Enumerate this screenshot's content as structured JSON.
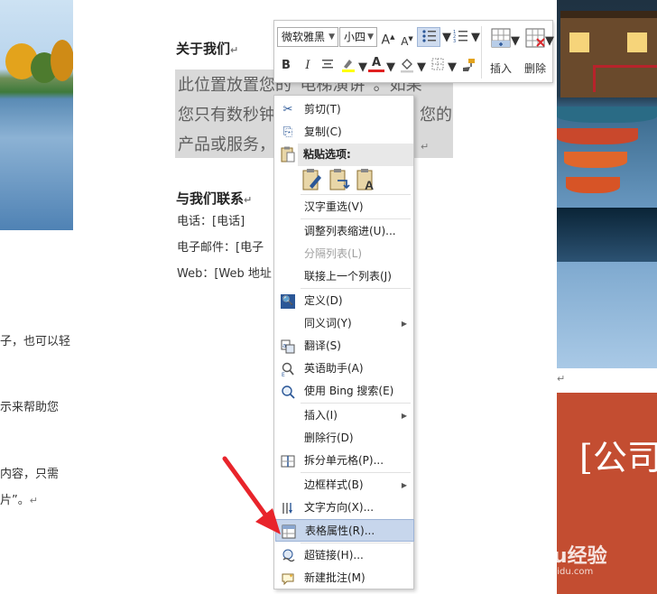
{
  "document": {
    "about_heading": "关于我们",
    "selected_lines": [
      "此位置放置您的“电梯演讲”。如果",
      "您只有数秒钟",
      "您的",
      "产品或服务，"
    ],
    "contact_heading": "与我们联系",
    "phone": "电话：[电话]",
    "email": "电子邮件：[电子",
    "web": "Web：[Web 地址",
    "left_fragments": [
      "子，也可以轻",
      "示来帮助您",
      "内容，只需",
      "片”。"
    ],
    "banner_title": "[公司",
    "para_mark": "↵"
  },
  "mini_toolbar": {
    "font_name": "微软雅黑",
    "font_size": "小四",
    "grow_font": "A",
    "shrink_font": "A",
    "bold": "B",
    "italic": "I",
    "font_color": "A",
    "insert_label": "插入",
    "delete_label": "删除",
    "colors": {
      "highlight": "#ffff00",
      "font": "#e02020",
      "accent": "#2b5797"
    }
  },
  "context_menu": {
    "items": [
      {
        "label": "剪切(T)",
        "icon": "scissors-icon",
        "glyph": "✂"
      },
      {
        "label": "复制(C)",
        "icon": "copy-icon",
        "glyph": "⎘"
      },
      {
        "label": "粘贴选项:",
        "icon": "clipboard-icon"
      },
      {
        "label": "汉字重选(V)"
      },
      {
        "label": "调整列表缩进(U)..."
      },
      {
        "label": "分隔列表(L)",
        "disabled": true
      },
      {
        "label": "联接上一个列表(J)"
      },
      {
        "label": "定义(D)",
        "icon": "define-icon"
      },
      {
        "label": "同义词(Y)",
        "submenu": true
      },
      {
        "label": "翻译(S)",
        "icon": "translate-icon"
      },
      {
        "label": "英语助手(A)",
        "icon": "english-assistant-icon"
      },
      {
        "label": "使用 Bing 搜索(E)",
        "icon": "bing-search-icon"
      },
      {
        "label": "插入(I)",
        "submenu": true
      },
      {
        "label": "删除行(D)"
      },
      {
        "label": "拆分单元格(P)...",
        "icon": "split-cell-icon"
      },
      {
        "label": "边框样式(B)",
        "submenu": true
      },
      {
        "label": "文字方向(X)...",
        "icon": "text-direction-icon"
      },
      {
        "label": "表格属性(R)...",
        "icon": "table-properties-icon",
        "highlighted": true
      },
      {
        "label": "超链接(H)...",
        "icon": "hyperlink-icon"
      },
      {
        "label": "新建批注(M)",
        "icon": "new-comment-icon"
      }
    ],
    "arrow_color": "#e8242b"
  },
  "watermark": {
    "main": "Baidu经验",
    "sub": "jingyan.baidu.com"
  }
}
